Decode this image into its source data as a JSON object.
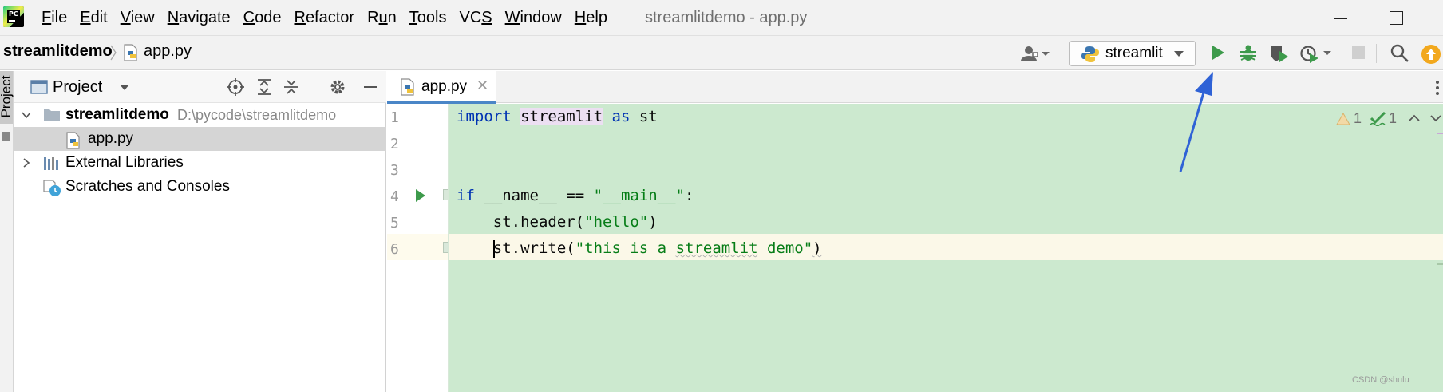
{
  "app": {
    "logo_text": "PC",
    "window_title": "streamlitdemo - app.py"
  },
  "menu": [
    {
      "label": "File",
      "mnemonic": "F",
      "rest": "ile"
    },
    {
      "label": "Edit",
      "mnemonic": "E",
      "rest": "dit"
    },
    {
      "label": "View",
      "mnemonic": "V",
      "rest": "iew"
    },
    {
      "label": "Navigate",
      "mnemonic": "N",
      "rest": "avigate"
    },
    {
      "label": "Code",
      "mnemonic": "C",
      "rest": "ode"
    },
    {
      "label": "Refactor",
      "mnemonic": "R",
      "rest": "efactor"
    },
    {
      "label": "Run",
      "pre": "R",
      "mnemonic": "u",
      "rest": "n"
    },
    {
      "label": "Tools",
      "mnemonic": "T",
      "rest": "ools"
    },
    {
      "label": "VCS",
      "pre": "VC",
      "mnemonic": "S",
      "rest": ""
    },
    {
      "label": "Window",
      "mnemonic": "W",
      "rest": "indow"
    },
    {
      "label": "Help",
      "mnemonic": "H",
      "rest": "elp"
    }
  ],
  "breadcrumb": {
    "project": "streamlitdemo",
    "file": "app.py"
  },
  "run_config": {
    "name": "streamlit"
  },
  "project_panel": {
    "title": "Project",
    "side_tab": "Project",
    "tree": [
      {
        "name": "streamlitdemo",
        "path": "D:\\pycode\\streamlitdemo"
      },
      {
        "name": "app.py"
      },
      {
        "name": "External Libraries"
      },
      {
        "name": "Scratches and Consoles"
      }
    ]
  },
  "editor": {
    "tab": "app.py",
    "inspections": {
      "warnings": "1",
      "weak_warnings": "1"
    },
    "lines": [
      "1",
      "2",
      "3",
      "4",
      "5",
      "6"
    ],
    "code": {
      "l1": {
        "kw1": "import",
        "mod": "streamlit",
        "kw2": "as",
        "alias": "st"
      },
      "l4": {
        "kw": "if",
        "name": "__name__ == ",
        "str": "\"__main__\"",
        "colon": ":"
      },
      "l5": {
        "call": "st.header(",
        "str": "\"hello\"",
        "close": ")"
      },
      "l6": {
        "call": "st.write(",
        "str_a": "\"this is a ",
        "str_b": "streamlit",
        "str_c": " demo\"",
        "close": ")"
      }
    }
  },
  "watermark": "CSDN @shulu",
  "colors": {
    "editor_bg": "#cce9cf",
    "keyword": "#0033b3",
    "string": "#067d17",
    "run_green": "#3d9a4b",
    "tab_accent": "#4a86c7",
    "annotation_arrow": "#2f62d6"
  }
}
